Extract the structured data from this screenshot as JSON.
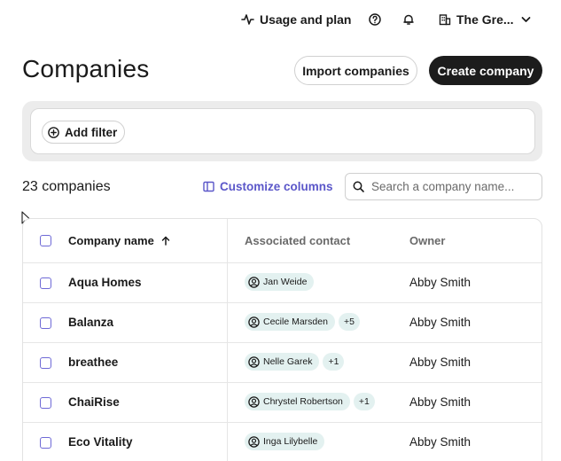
{
  "topbar": {
    "usage_label": "Usage and plan",
    "workspace_label": "The Gre..."
  },
  "header": {
    "title": "Companies",
    "import_label": "Import companies",
    "create_label": "Create company"
  },
  "filters": {
    "add_filter_label": "Add filter"
  },
  "toolbar": {
    "count_label": "23 companies",
    "customize_label": "Customize columns",
    "search_placeholder": "Search a company name..."
  },
  "table": {
    "columns": {
      "name": "Company name",
      "contact": "Associated contact",
      "owner": "Owner"
    },
    "rows": [
      {
        "name": "Aqua Homes",
        "contact": "Jan Weide",
        "extra": "",
        "owner": "Abby Smith"
      },
      {
        "name": "Balanza",
        "contact": "Cecile Marsden",
        "extra": "+5",
        "owner": "Abby Smith"
      },
      {
        "name": "breathee",
        "contact": "Nelle Garek",
        "extra": "+1",
        "owner": "Abby Smith"
      },
      {
        "name": "ChaiRise",
        "contact": "Chrystel Robertson",
        "extra": "+1",
        "owner": "Abby Smith"
      },
      {
        "name": "Eco Vitality",
        "contact": "Inga Lilybelle",
        "extra": "",
        "owner": "Abby Smith"
      }
    ]
  },
  "colors": {
    "accent": "#5b57c9",
    "checkbox_border": "#6e69d6",
    "chip_bg": "#e3f1f0",
    "primary_button": "#1c1c1c"
  },
  "icons": {
    "usage": "activity-pulse-icon",
    "help": "help-circle-icon",
    "bell": "bell-icon",
    "workspace": "building-icon",
    "chevron": "chevron-down-icon",
    "add_filter": "plus-circle-icon",
    "customize": "columns-icon",
    "search": "search-icon",
    "sort": "arrow-up-icon",
    "contact": "user-circle-icon"
  }
}
